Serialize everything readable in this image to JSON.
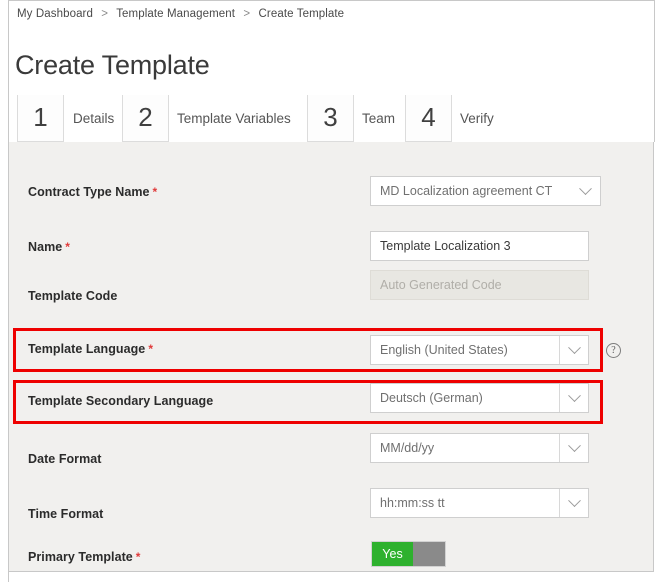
{
  "breadcrumb": {
    "items": [
      "My Dashboard",
      "Template Management",
      "Create Template"
    ],
    "separator": ">"
  },
  "page": {
    "title": "Create Template"
  },
  "wizard": {
    "steps": [
      {
        "number": "1",
        "label": "Details"
      },
      {
        "number": "2",
        "label": "Template Variables"
      },
      {
        "number": "3",
        "label": "Team"
      },
      {
        "number": "4",
        "label": "Verify"
      }
    ]
  },
  "form": {
    "fields": [
      {
        "label": "Contract Type Name",
        "required": "*",
        "value": "MD Localization agreement CT",
        "control": "dropdown"
      },
      {
        "label": "Name",
        "required": "*",
        "value": "Template Localization 3",
        "control": "text"
      },
      {
        "label": "Template Code",
        "required": "",
        "value": "Auto Generated Code",
        "control": "disabled-text"
      },
      {
        "label": "Template Language",
        "required": "*",
        "value": "English (United States)",
        "control": "dropdown-split",
        "highlighted": true,
        "help": "?"
      },
      {
        "label": "Template Secondary Language",
        "required": "",
        "value": "Deutsch (German)",
        "control": "dropdown-split",
        "highlighted": true
      },
      {
        "label": "Date Format",
        "required": "",
        "value": "MM/dd/yy",
        "control": "dropdown-split"
      },
      {
        "label": "Time Format",
        "required": "",
        "value": "hh:mm:ss tt",
        "control": "dropdown-split"
      },
      {
        "label": "Primary Template",
        "required": "*",
        "value": "Yes",
        "control": "toggle"
      }
    ]
  },
  "colors": {
    "highlight": "#ee0000",
    "required": "#e03a3a",
    "toggle_on": "#2eb12e",
    "toggle_off": "#8a8a8a",
    "panel_bg": "#f1f0ee"
  }
}
